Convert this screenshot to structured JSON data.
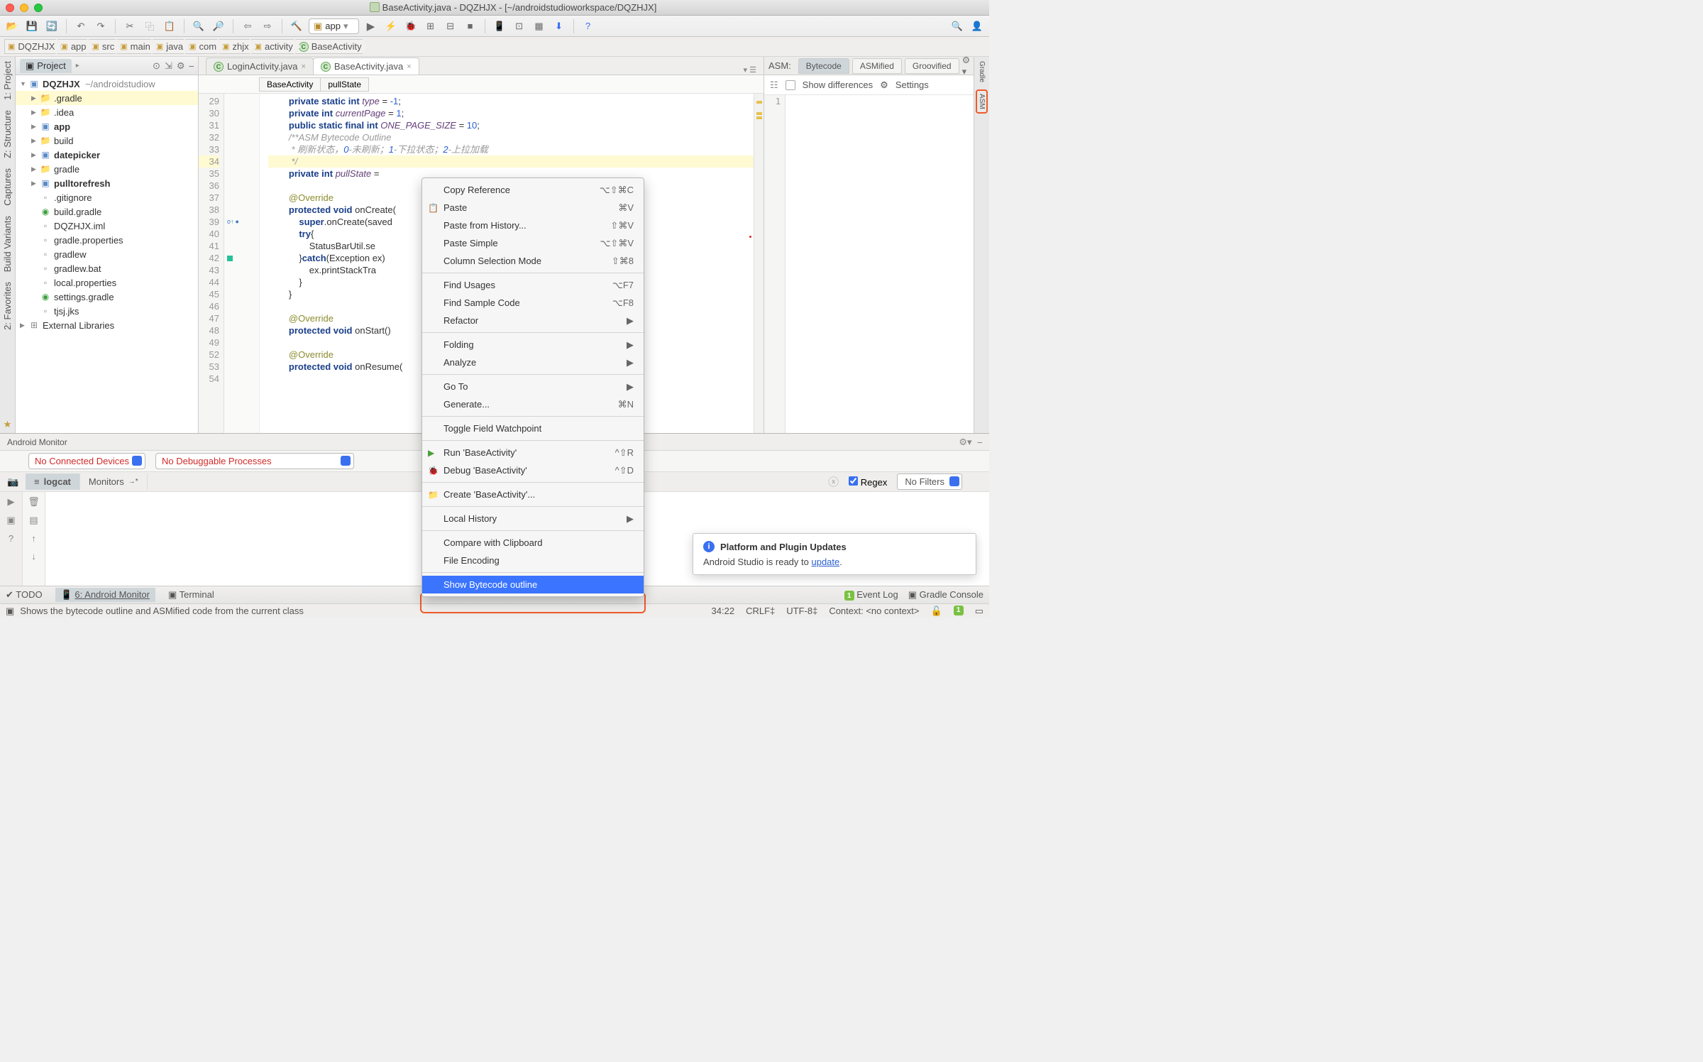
{
  "window": {
    "title": "BaseActivity.java - DQZHJX - [~/androidstudioworkspace/DQZHJX]"
  },
  "run_config": "app",
  "breadcrumb": [
    "DQZHJX",
    "app",
    "src",
    "main",
    "java",
    "com",
    "zhjx",
    "activity",
    "BaseActivity"
  ],
  "project": {
    "tab": "Project",
    "root": "DQZHJX",
    "root_suffix": "~/androidstudiow",
    "items": [
      {
        "icon": "fold",
        "label": ".gradle",
        "bold": false,
        "sel": true
      },
      {
        "icon": "fold",
        "label": ".idea",
        "bold": false
      },
      {
        "icon": "mod",
        "label": "app",
        "bold": true
      },
      {
        "icon": "fold",
        "label": "build",
        "bold": false
      },
      {
        "icon": "mod",
        "label": "datepicker",
        "bold": true
      },
      {
        "icon": "fold",
        "label": "gradle",
        "bold": false
      },
      {
        "icon": "mod",
        "label": "pulltorefresh",
        "bold": true
      },
      {
        "icon": "file",
        "label": ".gitignore",
        "leaf": true
      },
      {
        "icon": "gradle",
        "label": "build.gradle",
        "leaf": true
      },
      {
        "icon": "file",
        "label": "DQZHJX.iml",
        "leaf": true
      },
      {
        "icon": "file",
        "label": "gradle.properties",
        "leaf": true
      },
      {
        "icon": "file",
        "label": "gradlew",
        "leaf": true
      },
      {
        "icon": "file",
        "label": "gradlew.bat",
        "leaf": true
      },
      {
        "icon": "file",
        "label": "local.properties",
        "leaf": true
      },
      {
        "icon": "gradle",
        "label": "settings.gradle",
        "leaf": true
      },
      {
        "icon": "file",
        "label": "tjsj.jks",
        "leaf": true
      }
    ],
    "ext_lib": "External Libraries"
  },
  "editor": {
    "tabs": [
      {
        "label": "LoginActivity.java",
        "active": false
      },
      {
        "label": "BaseActivity.java",
        "active": true
      }
    ],
    "crumbs2": [
      "BaseActivity",
      "pullState"
    ],
    "gutter_start": 29,
    "lines": [
      "        private static int type = -1;",
      "        private int currentPage = 1;",
      "        public static final int ONE_PAGE_SIZE = 10;",
      "        /**ASM Bytecode Outline",
      "         * 刷新状态，0-未刷新；1-下拉状态；2-上拉加载",
      "         */",
      "        private int pullState = ",
      "",
      "        @Override",
      "        protected void onCreate(",
      "            super.onCreate(saved",
      "            try{",
      "                StatusBarUtil.se",
      "            }catch(Exception ex)",
      "                ex.printStackTra",
      "            }",
      "        }",
      "",
      "        @Override",
      "        protected void onStart()",
      "",
      "        @Override",
      "        protected void onResume("
    ],
    "line_numbers": [
      29,
      30,
      31,
      32,
      33,
      34,
      35,
      36,
      37,
      38,
      39,
      40,
      41,
      42,
      43,
      44,
      45,
      46,
      47,
      48,
      49,
      52,
      53,
      54
    ],
    "highlight_line": 34
  },
  "asm": {
    "label": "ASM:",
    "tabs": [
      "Bytecode",
      "ASMified",
      "Groovified"
    ],
    "show_diff": "Show differences",
    "settings": "Settings",
    "gutter": "1"
  },
  "monitor": {
    "title": "Android Monitor",
    "devices": "No Connected Devices",
    "processes": "No Debuggable Processes",
    "tabs": [
      "logcat",
      "Monitors"
    ],
    "regex": "Regex",
    "filter": "No Filters"
  },
  "context_menu": {
    "items": [
      {
        "label": "Copy Reference",
        "short": "⌥⇧⌘C"
      },
      {
        "label": "Paste",
        "short": "⌘V",
        "icon": "paste"
      },
      {
        "label": "Paste from History...",
        "short": "⇧⌘V"
      },
      {
        "label": "Paste Simple",
        "short": "⌥⇧⌘V"
      },
      {
        "label": "Column Selection Mode",
        "short": "⇧⌘8"
      },
      {
        "sep": true
      },
      {
        "label": "Find Usages",
        "short": "⌥F7"
      },
      {
        "label": "Find Sample Code",
        "short": "⌥F8"
      },
      {
        "label": "Refactor",
        "sub": true
      },
      {
        "sep": true
      },
      {
        "label": "Folding",
        "sub": true
      },
      {
        "label": "Analyze",
        "sub": true
      },
      {
        "sep": true
      },
      {
        "label": "Go To",
        "sub": true
      },
      {
        "label": "Generate...",
        "short": "⌘N"
      },
      {
        "sep": true
      },
      {
        "label": "Toggle Field Watchpoint"
      },
      {
        "sep": true
      },
      {
        "label": "Run 'BaseActivity'",
        "short": "^⇧R",
        "icon": "run"
      },
      {
        "label": "Debug 'BaseActivity'",
        "short": "^⇧D",
        "icon": "debug"
      },
      {
        "sep": true
      },
      {
        "label": "Create 'BaseActivity'...",
        "icon": "folder"
      },
      {
        "sep": true
      },
      {
        "label": "Local History",
        "sub": true
      },
      {
        "sep": true
      },
      {
        "label": "Compare with Clipboard"
      },
      {
        "label": "File Encoding"
      },
      {
        "sep": true
      },
      {
        "label": "Show Bytecode outline",
        "sel": true
      }
    ]
  },
  "notification": {
    "title": "Platform and Plugin Updates",
    "body_pre": "Android Studio is ready to ",
    "link": "update",
    "body_post": "."
  },
  "tool_strip": {
    "left": [
      "TODO",
      "6: Android Monitor",
      "Terminal"
    ],
    "right": [
      "Event Log",
      "Gradle Console"
    ]
  },
  "status": {
    "hint": "Shows the bytecode outline and ASMified code from the current class",
    "right": [
      "34:22",
      "CRLF‡",
      "UTF-8‡",
      "Context: <no context>"
    ]
  },
  "side_rails": {
    "left": [
      "1: Project",
      "Z: Structure",
      "Captures",
      "Build Variants",
      "2: Favorites"
    ],
    "right": [
      "Gradle",
      "ASM"
    ]
  }
}
